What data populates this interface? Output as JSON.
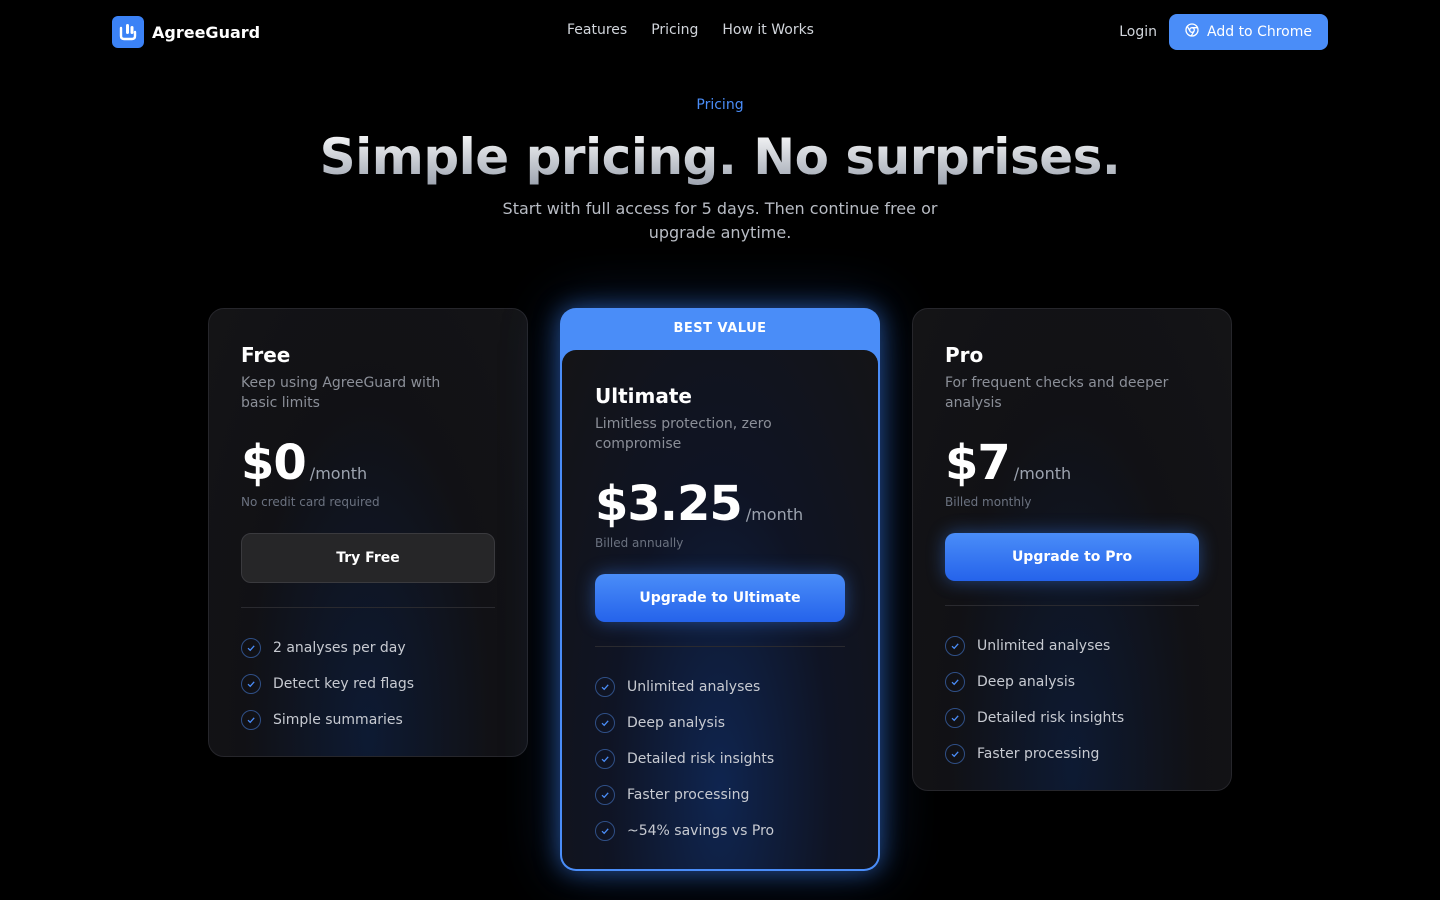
{
  "nav": {
    "brand": "AgreeGuard",
    "links": [
      "Features",
      "Pricing",
      "How it Works"
    ],
    "login": "Login",
    "cta": "Add to Chrome"
  },
  "hero": {
    "eyebrow": "Pricing",
    "title": "Simple pricing. No surprises.",
    "subtitle": "Start with full access for 5 days. Then continue free or upgrade anytime."
  },
  "plans": [
    {
      "name": "Free",
      "description": "Keep using AgreeGuard with basic limits",
      "price": "$0",
      "period": "/month",
      "billing": "No credit card required",
      "button": "Try Free",
      "features": [
        "2 analyses per day",
        "Detect key red flags",
        "Simple summaries"
      ]
    },
    {
      "badge": "BEST VALUE",
      "name": "Ultimate",
      "description": "Limitless protection, zero compromise",
      "price": "$3.25",
      "period": "/month",
      "billing": "Billed annually",
      "button": "Upgrade to Ultimate",
      "features": [
        "Unlimited analyses",
        "Deep analysis",
        "Detailed risk insights",
        "Faster processing",
        "~54% savings vs Pro"
      ]
    },
    {
      "name": "Pro",
      "description": "For frequent checks and deeper analysis",
      "price": "$7",
      "period": "/month",
      "billing": "Billed monthly",
      "button": "Upgrade to Pro",
      "features": [
        "Unlimited analyses",
        "Deep analysis",
        "Detailed risk insights",
        "Faster processing"
      ]
    }
  ],
  "colors": {
    "accent": "#4a8df8",
    "background": "#000000",
    "card": "#141416"
  },
  "icons": {
    "brand": "shield-hand-icon",
    "chrome": "chrome-icon",
    "feature": "check-circle-icon"
  }
}
